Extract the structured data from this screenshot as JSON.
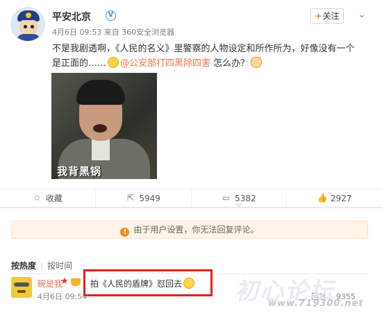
{
  "post": {
    "author": "平安北京",
    "verified_badge": "V",
    "meta": "4月6日 09:53 来自 360安全浏览器",
    "follow_label": "关注",
    "follow_icon": "plus-icon",
    "more_icon": "chevron-down-icon",
    "text_part1": "不是我剧透啊，《人民的名义》里警察的人物设定和所作所为，好像没有一个是正面的……",
    "mention": "@公安部打四黑除四害",
    "text_part2": " 怎么办？",
    "image_caption": "我背黑锅"
  },
  "actions": {
    "favorite_label": "收藏",
    "repost_count": "5949",
    "comment_count": "5382",
    "like_count": "2927"
  },
  "comments": {
    "notice": "由于用户设置，你无法回复评论。",
    "sort_hot": "按热度",
    "sort_time": "按时间",
    "items": [
      {
        "user": "碗是我",
        "text": "拍《人民的盾牌》怼回去",
        "date": "4月6日 09:54",
        "reply_label": "回复",
        "like_count": "9355"
      }
    ]
  },
  "watermark": {
    "title": "初心论坛",
    "url": "www.719300.net"
  },
  "colors": {
    "link": "#eb7350",
    "highlight_box": "#e4201c",
    "notice_bg": "#fef4e7"
  }
}
